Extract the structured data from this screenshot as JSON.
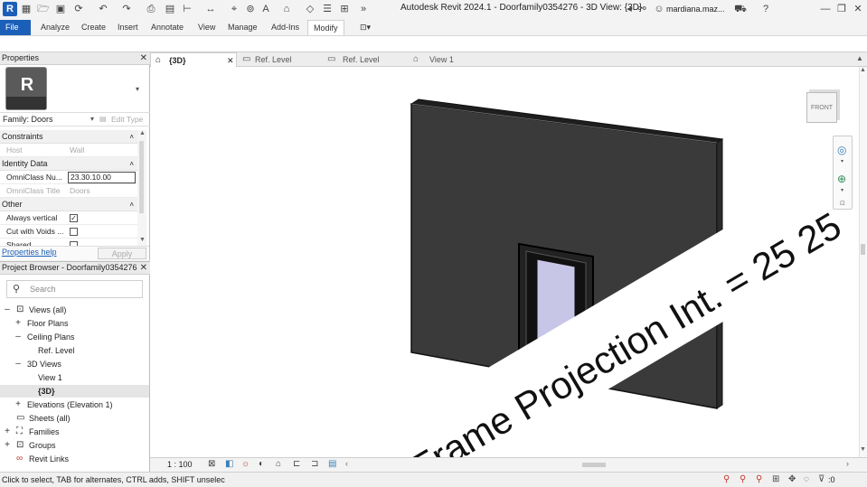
{
  "window": {
    "title": "Autodesk Revit 2024.1 - Doorfamily0354276 - 3D View: {3D}",
    "user": "mardiana.maz..."
  },
  "ribbon": {
    "tabs": [
      "File",
      "Analyze",
      "Create",
      "Insert",
      "Annotate",
      "View",
      "Manage",
      "Add-Ins",
      "Modify"
    ],
    "active_tab": "Modify"
  },
  "properties": {
    "title": "Properties",
    "type_selector": "Family: Doors",
    "edit_type_label": "Edit Type",
    "groups": {
      "constraints": "Constraints",
      "identity": "Identity Data",
      "other": "Other"
    },
    "rows": {
      "host_name": "Host",
      "host_value": "Wall",
      "omniclass_num_name": "OmniClass Nu...",
      "omniclass_num_value": "23.30.10.00",
      "omniclass_title_name": "OmniClass Title",
      "omniclass_title_value": "Doors",
      "always_vertical_name": "Always vertical",
      "always_vertical_checked": true,
      "cut_with_voids_name": "Cut with Voids ...",
      "cut_with_voids_checked": false,
      "shared_name": "Shared",
      "shared_checked": false
    },
    "help_link": "Properties help",
    "apply_label": "Apply"
  },
  "project_browser": {
    "title": "Project Browser - Doorfamily0354276",
    "search_placeholder": "Search",
    "tree": {
      "views_all": "Views (all)",
      "floor_plans": "Floor Plans",
      "ceiling_plans": "Ceiling Plans",
      "ref_level": "Ref. Level",
      "views_3d": "3D Views",
      "view1": "View 1",
      "view3d": "{3D}",
      "elevations": "Elevations (Elevation 1)",
      "sheets": "Sheets (all)",
      "families": "Families",
      "groups": "Groups",
      "revit_links": "Revit Links"
    }
  },
  "view_tabs": [
    {
      "label": "{3D}",
      "active": true
    },
    {
      "label": "Ref. Level",
      "active": false
    },
    {
      "label": "Ref. Level",
      "active": false
    },
    {
      "label": "View 1",
      "active": false
    }
  ],
  "viewport": {
    "annotation": "Frame Projection Int. = 25 25",
    "viewcube_face": "FRONT",
    "wall_color": "#3a3a3a",
    "glass_color": "#c8c6e6"
  },
  "view_control": {
    "scale": "1 : 100"
  },
  "status": {
    "hint": "Click to select, TAB for alternates, CTRL adds, SHIFT unselec",
    "filter_count": ":0"
  },
  "accent_color": "#1c5fb8"
}
